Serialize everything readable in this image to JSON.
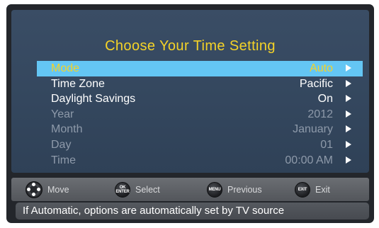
{
  "menu": {
    "title": "Choose Your Time Setting",
    "rows": [
      {
        "label": "Mode",
        "value": "Auto",
        "state": "selected"
      },
      {
        "label": "Time Zone",
        "value": "Pacific",
        "state": "active"
      },
      {
        "label": "Daylight Savings",
        "value": "On",
        "state": "active"
      },
      {
        "label": "Year",
        "value": "2012",
        "state": "dimmed"
      },
      {
        "label": "Month",
        "value": "January",
        "state": "dimmed"
      },
      {
        "label": "Day",
        "value": "01",
        "state": "dimmed"
      },
      {
        "label": "Time",
        "value": "00:00 AM",
        "state": "dimmed"
      }
    ]
  },
  "nav": {
    "move_label": "Move",
    "select_label": "Select",
    "select_icon_text": "OK ENTER",
    "previous_label": "Previous",
    "previous_icon_text": "MENU",
    "exit_label": "Exit",
    "exit_icon_text": "EXIT"
  },
  "status": {
    "message": "If Automatic, options are automatically set by TV source"
  },
  "colors": {
    "title": "#f5d327",
    "highlight": "#64c6f4",
    "panel": "#34475e",
    "dimmed_text": "#8e9aaa"
  }
}
